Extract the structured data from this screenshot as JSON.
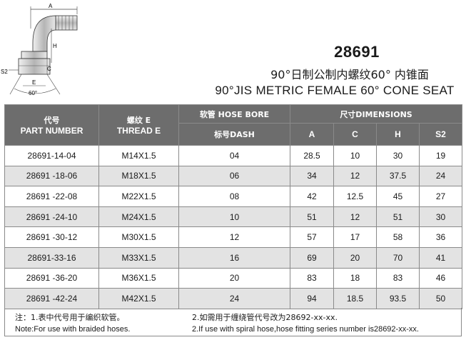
{
  "product": {
    "code": "28691",
    "title_cn": "90°日制公制内螺纹60° 内锥面",
    "title_en": "90°JIS METRIC FEMALE 60°  CONE SEAT"
  },
  "drawing": {
    "labels": {
      "a": "A",
      "h": "H",
      "c": "C",
      "e": "E",
      "s2": "S2",
      "angle": "60°"
    }
  },
  "table": {
    "headers": {
      "part_cn": "代号",
      "part_en": "PART NUMBER",
      "thread_cn": "螺纹 E",
      "thread_en": "THREAD E",
      "hose_bore": "软管 HOSE BORE",
      "dash": "标号DASH",
      "dimensions": "尺寸DIMENSIONS",
      "a": "A",
      "c": "C",
      "h": "H",
      "s2": "S2"
    },
    "rows": [
      {
        "part": "28691-14-04",
        "thread": "M14X1.5",
        "dash": "04",
        "a": "28.5",
        "c": "10",
        "h": "30",
        "s2": "19"
      },
      {
        "part": "28691 -18-06",
        "thread": "M18X1.5",
        "dash": "06",
        "a": "34",
        "c": "12",
        "h": "37.5",
        "s2": "24"
      },
      {
        "part": "28691 -22-08",
        "thread": "M22X1.5",
        "dash": "08",
        "a": "42",
        "c": "12.5",
        "h": "45",
        "s2": "27"
      },
      {
        "part": "28691 -24-10",
        "thread": "M24X1.5",
        "dash": "10",
        "a": "51",
        "c": "12",
        "h": "51",
        "s2": "30"
      },
      {
        "part": "28691 -30-12",
        "thread": "M30X1.5",
        "dash": "12",
        "a": "57",
        "c": "17",
        "h": "58",
        "s2": "36"
      },
      {
        "part": "28691-33-16",
        "thread": "M33X1.5",
        "dash": "16",
        "a": "69",
        "c": "20",
        "h": "70",
        "s2": "41"
      },
      {
        "part": "28691 -36-20",
        "thread": "M36X1.5",
        "dash": "20",
        "a": "83",
        "c": "18",
        "h": "83",
        "s2": "46"
      },
      {
        "part": "28691 -42-24",
        "thread": "M42X1.5",
        "dash": "24",
        "a": "94",
        "c": "18.5",
        "h": "93.5",
        "s2": "50"
      }
    ]
  },
  "notes": {
    "note1_cn": "注：1.表中代号用于编织软管。",
    "note1_en": "Note:For use with braided hoses.",
    "note2_cn": "2.如需用于缠绕管代号改为28692-xx-xx.",
    "note2_en": "2.If use with spiral hose,hose fitting series number is28692-xx-xx."
  }
}
